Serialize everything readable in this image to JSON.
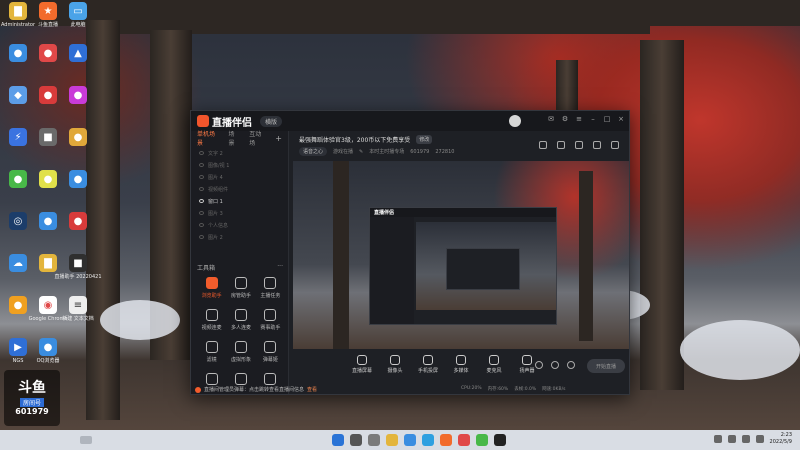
{
  "app": {
    "title": "直播伴侣",
    "mode_chip": "横版",
    "tabs": [
      "单机场景",
      "场景",
      "互动场"
    ],
    "tab_add": "+",
    "scenes": [
      "文字 2",
      "图像/视 1",
      "图片 4",
      "视频组件",
      "窗口 1",
      "图片 3",
      "个人信息",
      "图片 2"
    ],
    "tools_header": "工具箱",
    "tools_more": "···",
    "tools": [
      "浏览助手",
      "房管助手",
      "主播任务",
      "视频连麦",
      "多人连麦",
      "赛事助手",
      "滤镜",
      "虚拟形象",
      "弹幕姬",
      "",
      "",
      ""
    ],
    "notice_text": "直播间管理员弹幕：点击跳转查看直播间信息",
    "notice_link": "查看"
  },
  "room": {
    "title": "最强舞蹈体验官3级，200币以下免费享受",
    "edit_label": "修改",
    "meta_chip": "语音之心",
    "meta_items": [
      "游戏在播",
      "本时主时播专场",
      "601979",
      "272810"
    ]
  },
  "toolbar": {
    "buttons": [
      "直播屏幕",
      "摄像头",
      "手机投屏",
      "多媒体",
      "麦克风",
      "扬声器"
    ],
    "start_live": "开始直播"
  },
  "status_bar": [
    "CPU:20%",
    "内存:60%",
    "丢帧:0.0%",
    "网速:0KB/s"
  ],
  "brand": {
    "name": "斗鱼",
    "label": "房间号",
    "room_no": "601979"
  },
  "desktop_icons": [
    "Administrator",
    "斗鱼直播",
    "此电脑",
    "",
    "",
    "",
    "",
    "",
    "",
    "",
    "",
    "",
    "",
    "",
    "",
    "",
    "",
    "",
    "",
    "",
    "",
    "",
    "直播助手 20220421",
    "",
    "",
    "",
    "Google Chrome",
    "新建 文本文档",
    "NGS",
    "OQ浏览器",
    "",
    ""
  ],
  "taskbar": {
    "time": "2:23",
    "date": "2022/5/9"
  },
  "colors": {
    "accent": "#f25c2c",
    "window_bg": "#1e2025",
    "taskbar_bg": "#d9dde4"
  }
}
